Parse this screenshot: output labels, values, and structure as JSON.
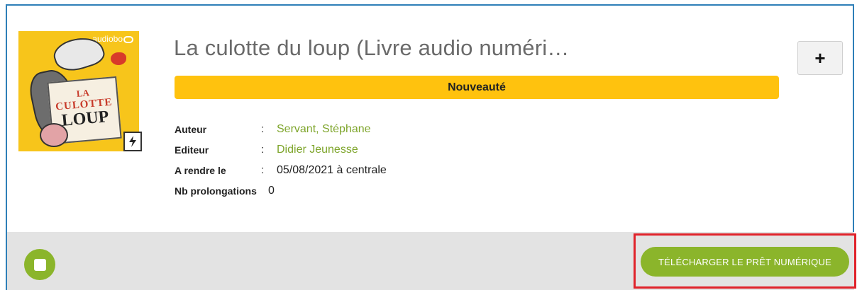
{
  "item": {
    "title": "La culotte du loup (Livre audio numéri…",
    "badge": "Nouveauté",
    "cover": {
      "brand": "audiobo",
      "line1": "LA",
      "line2": "CULOTTE",
      "line3": "LOUP"
    },
    "meta": [
      {
        "label": "Auteur",
        "colon": ":",
        "value": "Servant, Stéphane"
      },
      {
        "label": "Editeur",
        "colon": ":",
        "value": "Didier Jeunesse"
      },
      {
        "label": "A rendre le",
        "colon": ":",
        "value": "05/08/2021 à centrale"
      },
      {
        "label": "Nb prolongations",
        "value": "0"
      }
    ],
    "plus_label": "+"
  },
  "footer": {
    "download_label": "TÉLÉCHARGER LE PRÊT NUMÉRIQUE"
  },
  "colors": {
    "accent_green": "#8bb52b",
    "badge_yellow": "#ffc20e",
    "link_green": "#7ea52b",
    "highlight_red": "#e0222a",
    "card_border": "#2e7fb8"
  },
  "icons": {
    "flash": "lightning-icon",
    "add": "plus-icon",
    "select": "checkbox-icon"
  }
}
